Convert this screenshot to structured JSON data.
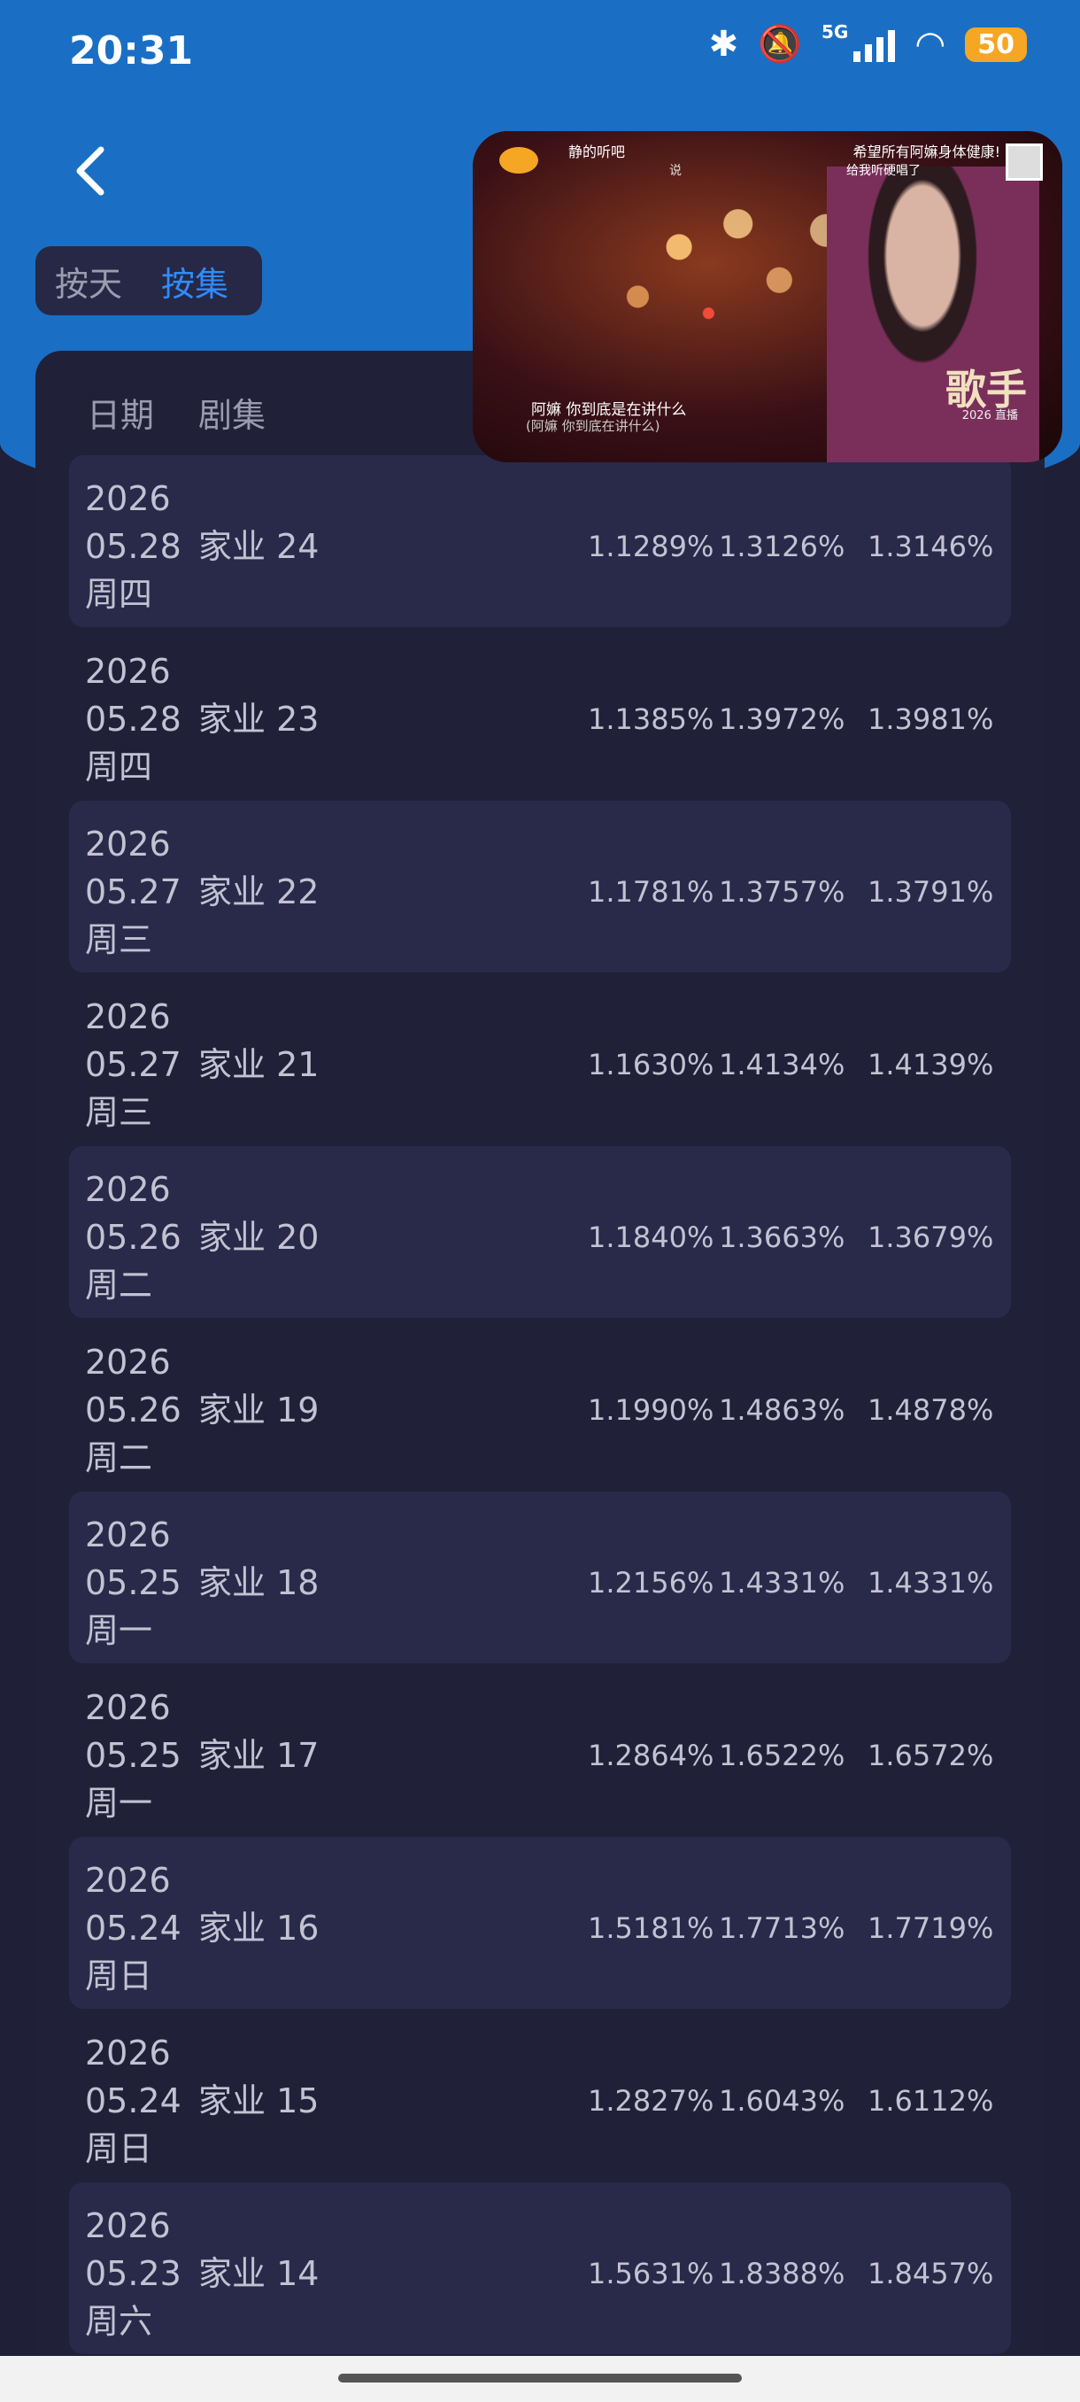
{
  "status_bar": {
    "time": "20:31",
    "network": "5G",
    "battery": "50",
    "icons": [
      "bluetooth-icon",
      "mute-icon",
      "signal-icon",
      "wifi-icon",
      "battery-icon"
    ]
  },
  "toggle": {
    "day_label": "按天",
    "episode_label": "按集"
  },
  "table_header": {
    "date": "日期",
    "episode": "剧集"
  },
  "rows": [
    {
      "year": "2026",
      "md": "05.28",
      "weekday": "周四",
      "title": "家业 24",
      "v1": "1.1289%",
      "v2": "1.3126%",
      "v3": "1.3146%"
    },
    {
      "year": "2026",
      "md": "05.28",
      "weekday": "周四",
      "title": "家业 23",
      "v1": "1.1385%",
      "v2": "1.3972%",
      "v3": "1.3981%"
    },
    {
      "year": "2026",
      "md": "05.27",
      "weekday": "周三",
      "title": "家业 22",
      "v1": "1.1781%",
      "v2": "1.3757%",
      "v3": "1.3791%"
    },
    {
      "year": "2026",
      "md": "05.27",
      "weekday": "周三",
      "title": "家业 21",
      "v1": "1.1630%",
      "v2": "1.4134%",
      "v3": "1.4139%"
    },
    {
      "year": "2026",
      "md": "05.26",
      "weekday": "周二",
      "title": "家业 20",
      "v1": "1.1840%",
      "v2": "1.3663%",
      "v3": "1.3679%"
    },
    {
      "year": "2026",
      "md": "05.26",
      "weekday": "周二",
      "title": "家业 19",
      "v1": "1.1990%",
      "v2": "1.4863%",
      "v3": "1.4878%"
    },
    {
      "year": "2026",
      "md": "05.25",
      "weekday": "周一",
      "title": "家业 18",
      "v1": "1.2156%",
      "v2": "1.4331%",
      "v3": "1.4331%"
    },
    {
      "year": "2026",
      "md": "05.25",
      "weekday": "周一",
      "title": "家业 17",
      "v1": "1.2864%",
      "v2": "1.6522%",
      "v3": "1.6572%"
    },
    {
      "year": "2026",
      "md": "05.24",
      "weekday": "周日",
      "title": "家业 16",
      "v1": "1.5181%",
      "v2": "1.7713%",
      "v3": "1.7719%"
    },
    {
      "year": "2026",
      "md": "05.24",
      "weekday": "周日",
      "title": "家业 15",
      "v1": "1.2827%",
      "v2": "1.6043%",
      "v3": "1.6112%"
    },
    {
      "year": "2026",
      "md": "05.23",
      "weekday": "周六",
      "title": "家业 14",
      "v1": "1.5631%",
      "v2": "1.8388%",
      "v3": "1.8457%"
    }
  ],
  "pip_video": {
    "top_left_text": "静的听吧",
    "top_middle_text": "说",
    "top_right_text": "希望所有阿嫲身体健康!",
    "top_right_sub": "给我听硬唱了",
    "subtitle_line1": "阿嫲 你到底是在讲什么",
    "subtitle_line2": "(阿嫲 你到底在讲什么)",
    "show_name": "歌手",
    "show_year": "2026",
    "show_tag": "直播"
  },
  "colors": {
    "header_blue": "#1a6fc4",
    "accent": "#2f8bff",
    "panel": "#202038",
    "battery": "#f5a623"
  }
}
